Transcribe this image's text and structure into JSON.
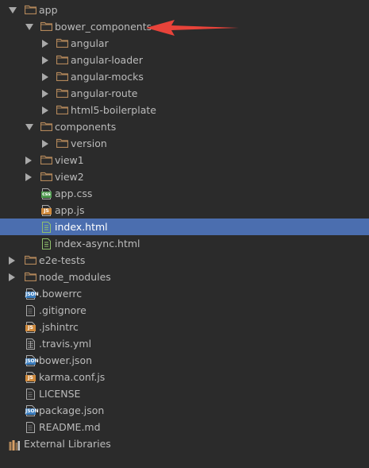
{
  "tree": {
    "items": [
      {
        "label": "app",
        "type": "folder",
        "state": "open",
        "level": 0
      },
      {
        "label": "bower_components",
        "type": "folder",
        "state": "open",
        "level": 1
      },
      {
        "label": "angular",
        "type": "folder",
        "state": "closed",
        "level": 2
      },
      {
        "label": "angular-loader",
        "type": "folder",
        "state": "closed",
        "level": 2
      },
      {
        "label": "angular-mocks",
        "type": "folder",
        "state": "closed",
        "level": 2
      },
      {
        "label": "angular-route",
        "type": "folder",
        "state": "closed",
        "level": 2
      },
      {
        "label": "html5-boilerplate",
        "type": "folder",
        "state": "closed",
        "level": 2
      },
      {
        "label": "components",
        "type": "folder",
        "state": "open",
        "level": 1
      },
      {
        "label": "version",
        "type": "folder",
        "state": "closed",
        "level": 2
      },
      {
        "label": "view1",
        "type": "folder",
        "state": "closed",
        "level": 1
      },
      {
        "label": "view2",
        "type": "folder",
        "state": "closed",
        "level": 1
      },
      {
        "label": "app.css",
        "type": "file",
        "icon": "css-file-icon",
        "badge": "css",
        "level": 1
      },
      {
        "label": "app.js",
        "type": "file",
        "icon": "js-file-icon",
        "badge": "JS",
        "level": 1
      },
      {
        "label": "index.html",
        "type": "file",
        "icon": "html-file-icon",
        "badge": "",
        "level": 1,
        "selected": true
      },
      {
        "label": "index-async.html",
        "type": "file",
        "icon": "html-file-icon",
        "badge": "",
        "level": 1
      },
      {
        "label": "e2e-tests",
        "type": "folder",
        "state": "closed",
        "level": 0
      },
      {
        "label": "node_modules",
        "type": "folder",
        "state": "closed",
        "level": 0
      },
      {
        "label": ".bowerrc",
        "type": "file",
        "icon": "json-file-icon",
        "badge": "JSON",
        "level": 0
      },
      {
        "label": ".gitignore",
        "type": "file",
        "icon": "text-file-icon",
        "badge": "",
        "level": 0
      },
      {
        "label": ".jshintrc",
        "type": "file",
        "icon": "js-file-icon",
        "badge": "JS",
        "level": 0
      },
      {
        "label": ".travis.yml",
        "type": "file",
        "icon": "yml-file-icon",
        "badge": "",
        "level": 0
      },
      {
        "label": "bower.json",
        "type": "file",
        "icon": "json-file-icon",
        "badge": "JSON",
        "level": 0
      },
      {
        "label": "karma.conf.js",
        "type": "file",
        "icon": "js-file-icon",
        "badge": "JS",
        "level": 0
      },
      {
        "label": "LICENSE",
        "type": "file",
        "icon": "text-file-icon",
        "badge": "",
        "level": 0
      },
      {
        "label": "package.json",
        "type": "file",
        "icon": "json-file-icon",
        "badge": "JSON",
        "level": 0
      },
      {
        "label": "README.md",
        "type": "file",
        "icon": "markdown-file-icon",
        "badge": "",
        "level": 0
      },
      {
        "label": "External Libraries",
        "type": "library",
        "icon": "external-libraries-icon",
        "level": -1
      }
    ]
  },
  "colors": {
    "background": "#2b2b2b",
    "selection": "#4b6eaf",
    "folder": "#b2875a",
    "annotation_arrow": "#e8433a"
  }
}
